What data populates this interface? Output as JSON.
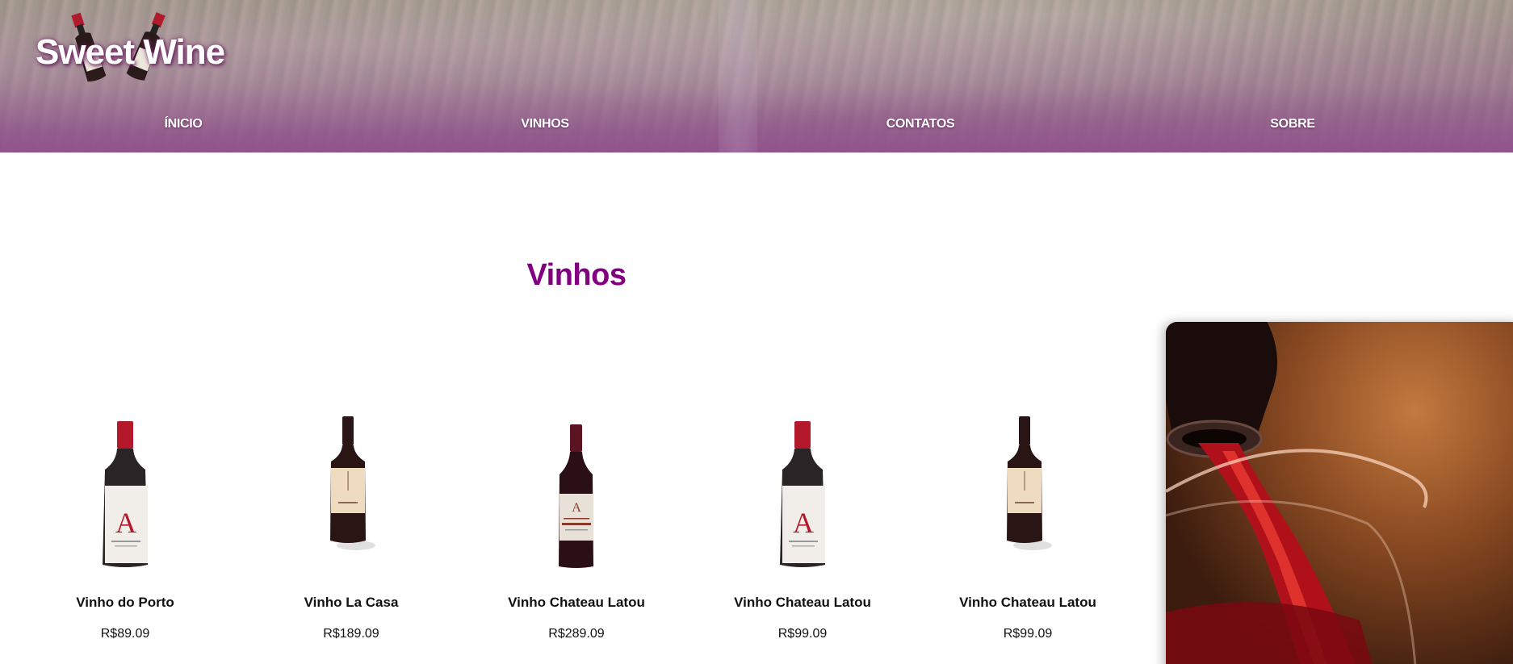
{
  "header": {
    "logo_text": "Sweet Wine",
    "logo_icon": "wine-bottles-icon",
    "nav": [
      {
        "label": "ÍNICIO"
      },
      {
        "label": "VINHOS"
      },
      {
        "label": "CONTATOS"
      },
      {
        "label": "SOBRE"
      }
    ]
  },
  "main": {
    "title": "Vinhos",
    "products": [
      {
        "name": "Vinho do Porto",
        "price": "R$89.09",
        "bottle": "white-label-A"
      },
      {
        "name": "Vinho La Casa",
        "price": "R$189.09",
        "bottle": "dark-cream-label"
      },
      {
        "name": "Vinho Chateau Latou",
        "price": "R$289.09",
        "bottle": "bordeaux-latour"
      },
      {
        "name": "Vinho Chateau Latou",
        "price": "R$99.09",
        "bottle": "white-label-A"
      },
      {
        "name": "Vinho Chateau Latou",
        "price": "R$99.09",
        "bottle": "dark-cream-label"
      }
    ],
    "side_image": "wine-pouring-into-glass"
  },
  "colors": {
    "accent": "#800080",
    "header_purple": "#803a78",
    "text": "#111111"
  }
}
